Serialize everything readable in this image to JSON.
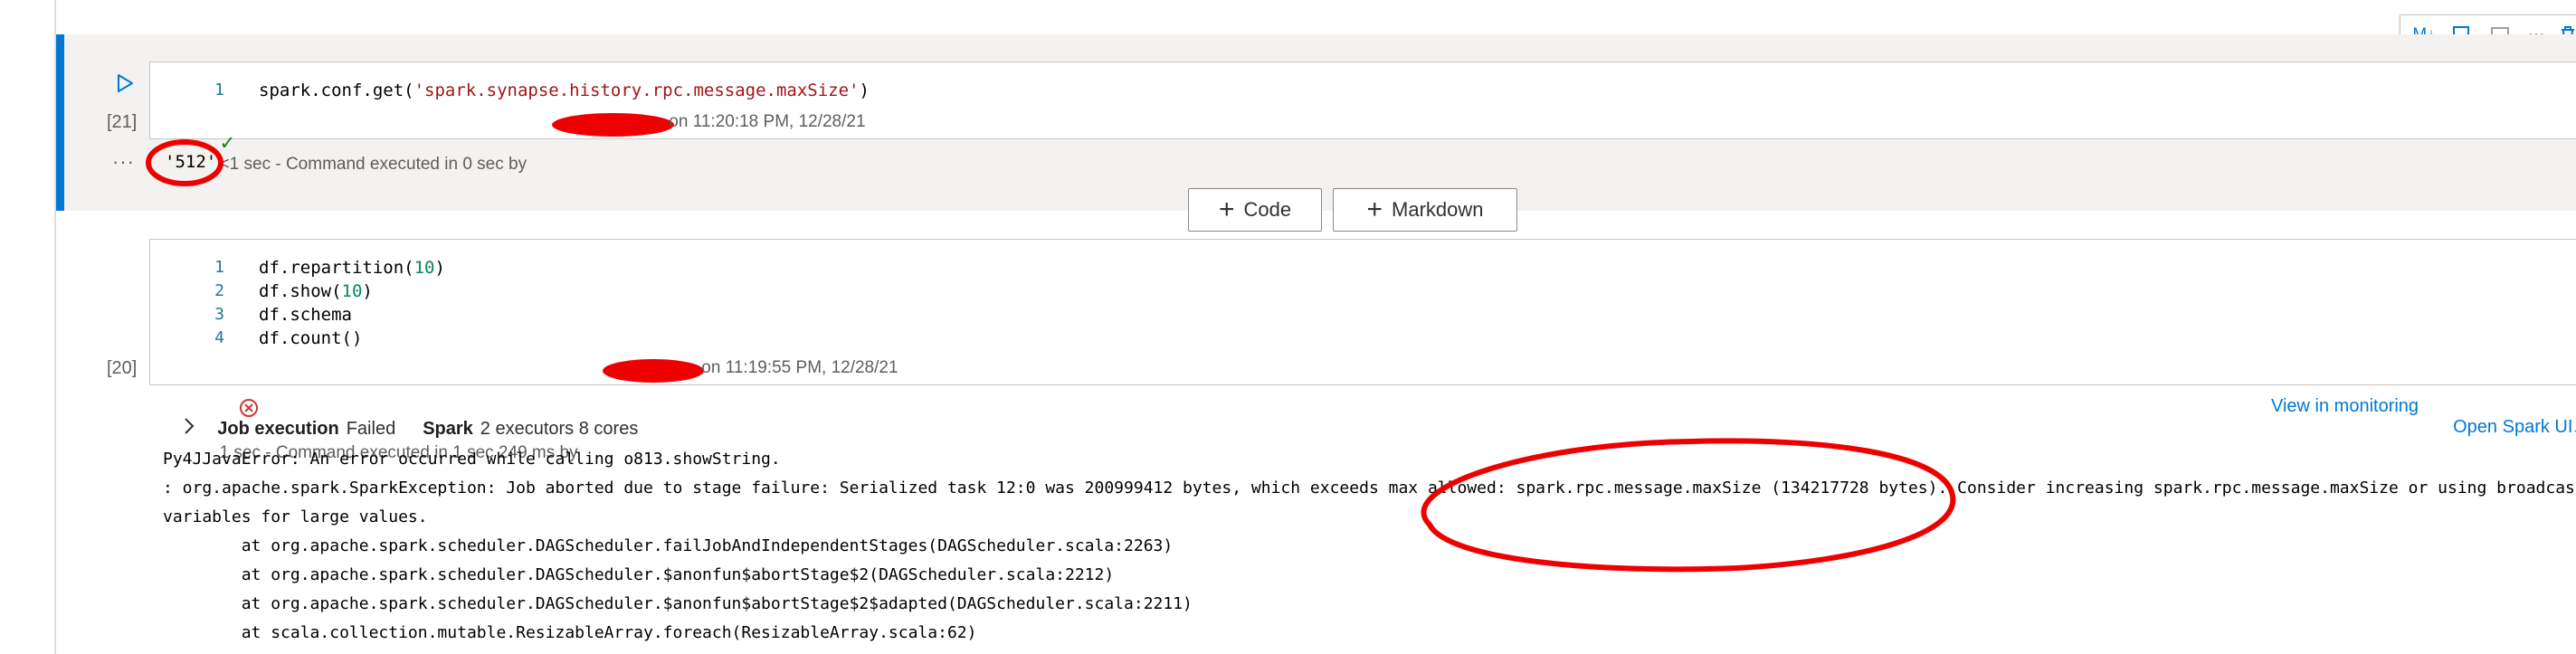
{
  "cell1": {
    "exec_count": "[21]",
    "line_numbers": [
      "1"
    ],
    "code_prefix": "spark.conf.get(",
    "code_string": "'spark.synapse.history.rpc.message.maxSize'",
    "code_suffix": ")",
    "status_time": "<1 sec - Command executed in 0 sec by ",
    "status_when": " on 11:20:18 PM, 12/28/21",
    "output": "'512'",
    "output_ellipsis": "···"
  },
  "add_cell": {
    "code_label": "Code",
    "markdown_label": "Markdown"
  },
  "toolbar": {
    "ml_label": "M↓",
    "more_label": "···"
  },
  "cell2": {
    "exec_count": "[20]",
    "line_numbers": [
      "1",
      "2",
      "3",
      "4"
    ],
    "lines": [
      {
        "pre": "df.repartition(",
        "num": "10",
        "post": ")"
      },
      {
        "pre": "df.show(",
        "num": "10",
        "post": ")"
      },
      {
        "pre": "df.schema",
        "num": "",
        "post": ""
      },
      {
        "pre": "df.count()",
        "num": "",
        "post": ""
      }
    ],
    "status_time": "1 sec - Command executed in 1 sec 249 ms by ",
    "status_when": " on 11:19:55 PM, 12/28/21"
  },
  "job": {
    "label": "Job execution",
    "state": "Failed",
    "spark_label": "Spark",
    "spark_detail": "2 executors 8 cores",
    "view_monitoring": "View in monitoring",
    "open_spark_ui": "Open Spark UI"
  },
  "error_lines": [
    "Py4JJavaError: An error occurred while calling o813.showString.",
    ": org.apache.spark.SparkException: Job aborted due to stage failure: Serialized task 12:0 was 200999412 bytes, which exceeds max allowed: spark.rpc.message.maxSize (134217728 bytes). Consider increasing spark.rpc.message.maxSize or using broadcast",
    "variables for large values.",
    "        at org.apache.spark.scheduler.DAGScheduler.failJobAndIndependentStages(DAGScheduler.scala:2263)",
    "        at org.apache.spark.scheduler.DAGScheduler.$anonfun$abortStage$2(DAGScheduler.scala:2212)",
    "        at org.apache.spark.scheduler.DAGScheduler.$anonfun$abortStage$2$adapted(DAGScheduler.scala:2211)",
    "        at scala.collection.mutable.ResizableArray.foreach(ResizableArray.scala:62)"
  ],
  "colors": {
    "accent": "#0078d4",
    "success": "#107c10",
    "error": "#d13438",
    "annotation": "#ee0000"
  }
}
